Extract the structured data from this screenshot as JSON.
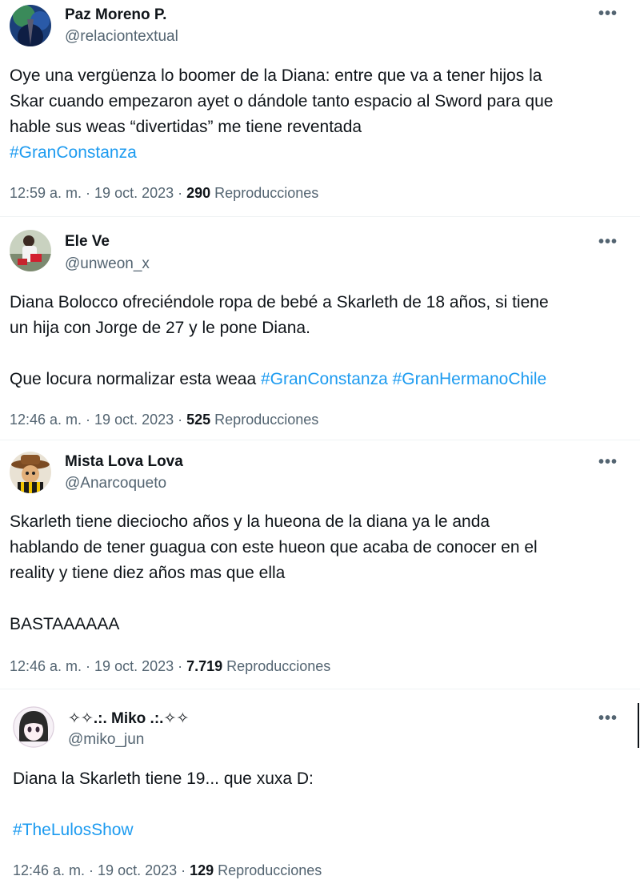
{
  "tweets": [
    {
      "name": "Paz Moreno P.",
      "handle": "@relaciontextual",
      "more_icon": "•••",
      "lines": [
        [
          {
            "t": "Oye una vergüenza lo boomer de la Diana: entre que va a tener hijos la"
          }
        ],
        [
          {
            "t": "Skar cuando empezaron ayet o dándole tanto espacio al Sword para que"
          }
        ],
        [
          {
            "t": "hable sus weas “divertidas” me tiene reventada"
          }
        ],
        [
          {
            "t": "#GranConstanza",
            "tag": true
          }
        ]
      ],
      "time": "12:59 a. m. · 19 oct. 2023 · ",
      "views": "290",
      "views_label": " Reproducciones"
    },
    {
      "name": "Ele Ve",
      "handle": "@unweon_x",
      "more_icon": "•••",
      "lines": [
        [
          {
            "t": "Diana Bolocco ofreciéndole ropa de bebé a Skarleth de 18 años, si tiene"
          }
        ],
        [
          {
            "t": "un hija con Jorge de 27 y le pone Diana."
          }
        ],
        [],
        [
          {
            "t": "Que locura normalizar esta weaa "
          },
          {
            "t": "#GranConstanza",
            "tag": true
          },
          {
            "t": " "
          },
          {
            "t": "#GranHermanoChile",
            "tag": true
          }
        ]
      ],
      "time": "12:46 a. m. · 19 oct. 2023 · ",
      "views": "525",
      "views_label": " Reproducciones"
    },
    {
      "name": "Mista Lova Lova",
      "handle": "@Anarcoqueto",
      "more_icon": "•••",
      "lines": [
        [
          {
            "t": "Skarleth tiene dieciocho años y la hueona de la diana ya le anda"
          }
        ],
        [
          {
            "t": "hablando de tener guagua con este hueon que acaba de conocer en el"
          }
        ],
        [
          {
            "t": "reality y tiene diez años mas que ella"
          }
        ],
        [],
        [
          {
            "t": "BASTAAAAAA"
          }
        ]
      ],
      "time": "12:46 a. m. · 19 oct. 2023 · ",
      "views": "7.719",
      "views_label": " Reproducciones"
    },
    {
      "name": "✧✧.:. Miko .:.✧✧",
      "handle": "@miko_jun",
      "more_icon": "•••",
      "lines": [
        [
          {
            "t": "Diana la Skarleth tiene 19... que xuxa D:"
          }
        ],
        [],
        [
          {
            "t": "#TheLulosShow",
            "tag": true
          }
        ]
      ],
      "time": "12:46 a. m. · 19 oct. 2023 · ",
      "views": "129",
      "views_label": " Reproducciones"
    }
  ]
}
